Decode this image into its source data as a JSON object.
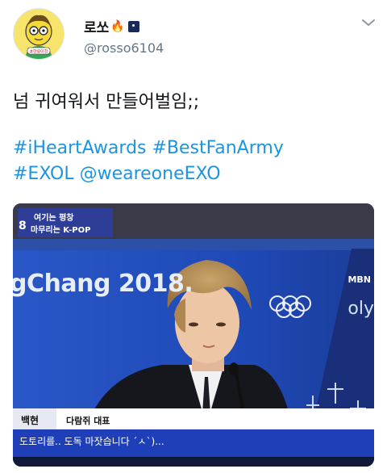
{
  "author": {
    "display_name": "로쏘",
    "emoji_fire": "🔥",
    "emoji_night": "🌌",
    "handle": "@rosso6104",
    "avatar_badge": "#한영이천",
    "avatar_icon": "avatar-cartoon"
  },
  "header": {
    "menu_icon": "chevron-down-icon"
  },
  "tweet": {
    "text": "넘 귀여워서 만들어벌임;;",
    "hashtags_line1": [
      "#iHeartAwards",
      "#BestFanArmy"
    ],
    "hashtags_line2": [
      "#EXOL",
      "@weareoneEXO"
    ]
  },
  "media": {
    "overlay_top": "여기는 평창",
    "overlay_bottom": "마무리는 K-POP",
    "overlay_number": "8",
    "background_text": "gChang 2018.",
    "channel_logo": "MBN",
    "background_right": "oly",
    "caption_name": "백현",
    "caption_role": "다람쥐 대표",
    "subtitle": "도토리를.. 도독 마잣습니다 ´ㅅ`)..."
  },
  "colors": {
    "link": "#1b95e0",
    "handle": "#657786",
    "tv_blue": "#1e3a8a",
    "caption_bar": "#1f3fb8"
  }
}
